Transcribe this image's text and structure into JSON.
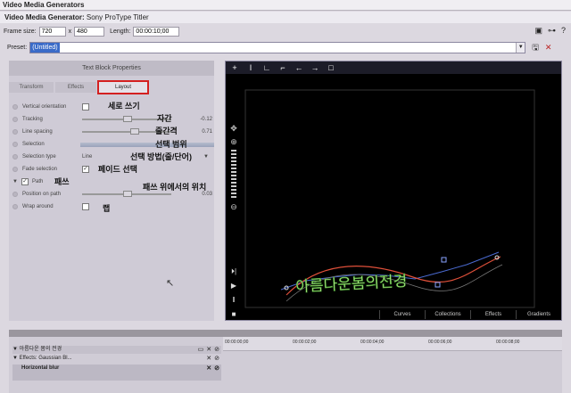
{
  "window": {
    "title": "Video Media Generators",
    "subtitle_prefix": "Video Media Generator:",
    "subtitle_plugin": "Sony ProType Titler"
  },
  "frame": {
    "size_label": "Frame size:",
    "width": "720",
    "times": "x",
    "height": "480",
    "length_label": "Length:",
    "length": "00:00:10;00"
  },
  "preset": {
    "label": "Preset:",
    "value": "(Untitled)"
  },
  "panel": {
    "header": "Text Block Properties",
    "tabs": [
      "Transform",
      "Effects",
      "Layout"
    ],
    "active_tab": "Layout",
    "rows": {
      "vertical": "Vertical orientation",
      "tracking": "Tracking",
      "tracking_value": "-0.12",
      "line_spacing": "Line spacing",
      "line_spacing_value": "0.71",
      "selection": "Selection",
      "selection_type": "Selection type",
      "selection_type_value": "Line",
      "fade_selection": "Fade selection",
      "path": "Path",
      "position_on_path": "Position on path",
      "position_value": "0.03",
      "wrap_around": "Wrap around"
    },
    "annotations": {
      "vertical": "세로 쓰기",
      "tracking": "자간",
      "line_spacing": "줄간격",
      "selection": "선택 범위",
      "selection_type": "선택 방법(줄/단어)",
      "fade": "페이드 선택",
      "path": "패쓰",
      "position": "패쓰 위에서의 위치",
      "wrap": "랩"
    }
  },
  "preview": {
    "text": "아름다운봄의전경",
    "tabs": [
      "Curves",
      "Collections",
      "Effects",
      "Gradients"
    ]
  },
  "timeline": {
    "ticks": [
      "00:00:00;00",
      "00:00:02;00",
      "00:00:04;00",
      "00:00:06;00",
      "00:00:08;00"
    ],
    "track1": "아름다운 봄의 전경",
    "track2": "Effects: Gaussian Bl...",
    "track3": "Horizontal blur"
  },
  "colors": {
    "glow_text": "#b8f08a",
    "path_curve": "#e0503a",
    "path_control": "#4a6ad0",
    "highlight": "#d42020"
  }
}
